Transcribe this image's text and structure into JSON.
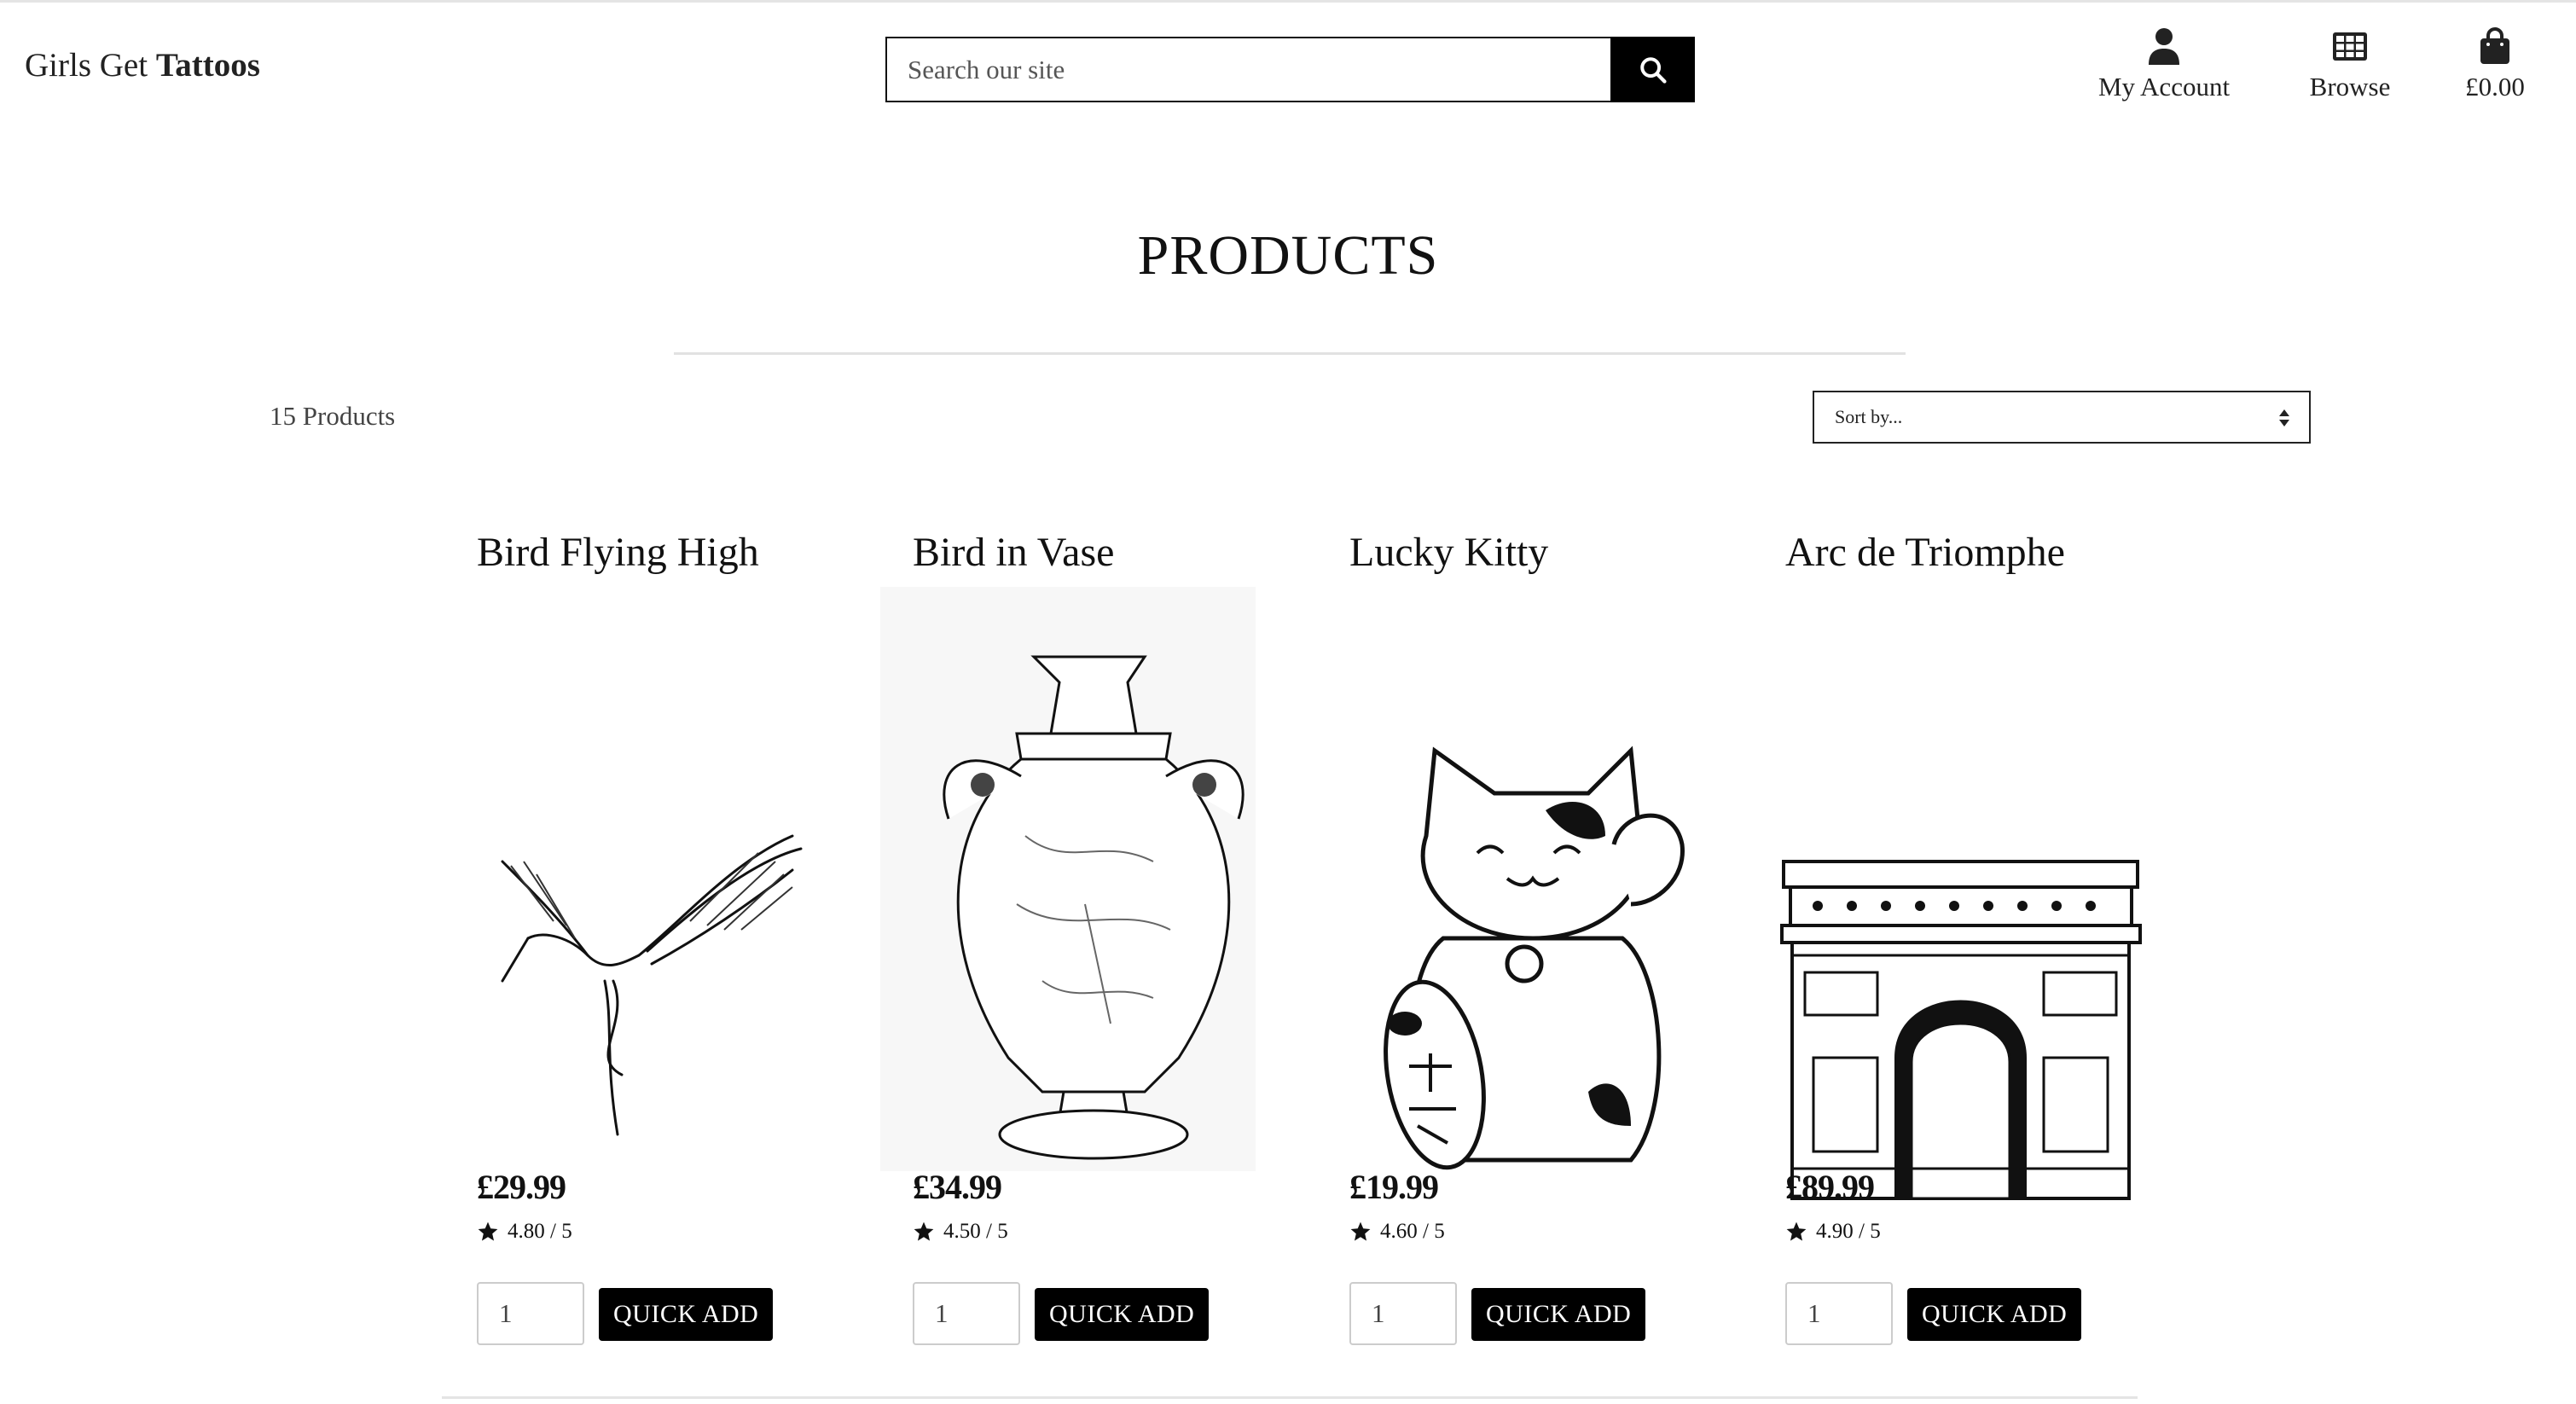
{
  "header": {
    "brand_light": "Girls Get ",
    "brand_bold": "Tattoos",
    "search_placeholder": "Search our site",
    "nav": {
      "account": {
        "label": "My Account",
        "icon": "user-icon"
      },
      "browse": {
        "label": "Browse",
        "icon": "grid-icon"
      },
      "bag": {
        "label": "£0.00",
        "icon": "shopping-bag-icon"
      }
    }
  },
  "main": {
    "title": "PRODUCTS",
    "count_label": "15 Products",
    "sort_label": "Sort by...",
    "products": [
      {
        "name": "Bird Flying High",
        "price": "£29.99",
        "rating": "4.80 / 5",
        "qty": "1",
        "button": "QUICK ADD",
        "image": "crane-flying-drawing"
      },
      {
        "name": "Bird in Vase",
        "price": "£34.99",
        "rating": "4.50 / 5",
        "qty": "1",
        "button": "QUICK ADD",
        "image": "vase-with-crane-drawing"
      },
      {
        "name": "Lucky Kitty",
        "price": "£19.99",
        "rating": "4.60 / 5",
        "qty": "1",
        "button": "QUICK ADD",
        "image": "lucky-cat-drawing"
      },
      {
        "name": "Arc de Triomphe",
        "price": "£89.99",
        "rating": "4.90 / 5",
        "qty": "1",
        "button": "QUICK ADD",
        "image": "arc-de-triomphe-drawing"
      }
    ]
  },
  "colors": {
    "accent": "#000000",
    "text": "#111111",
    "muted": "#444444",
    "rule": "#e2e2e2"
  }
}
